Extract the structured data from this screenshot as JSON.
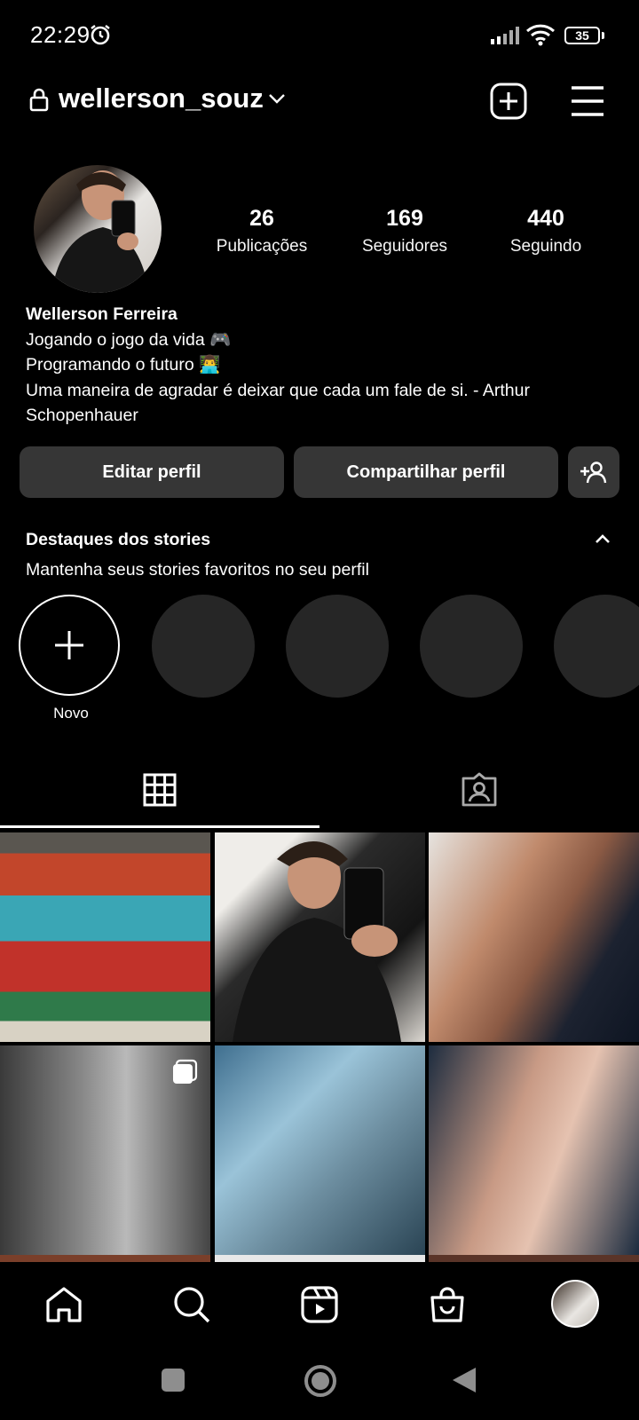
{
  "status_bar": {
    "time": "22:29",
    "battery": "35"
  },
  "header": {
    "username": "wellerson_souz"
  },
  "profile": {
    "stats": [
      {
        "count": "26",
        "label": "Publicações"
      },
      {
        "count": "169",
        "label": "Seguidores"
      },
      {
        "count": "440",
        "label": "Seguindo"
      }
    ],
    "name": "Wellerson Ferreira",
    "bio_lines": [
      "Jogando o jogo da vida 🎮",
      "Programando o futuro 👨‍💻",
      "Uma maneira de agradar é deixar que cada um fale de si. - Arthur",
      "Schopenhauer"
    ]
  },
  "actions": {
    "edit": "Editar perfil",
    "share": "Compartilhar perfil"
  },
  "highlights": {
    "title": "Destaques dos stories",
    "subtitle": "Mantenha seus stories favoritos no seu perfil",
    "new_label": "Novo"
  },
  "icons": {
    "header": [
      "lock-icon",
      "chevron-down-icon",
      "new-post-icon",
      "menu-icon"
    ],
    "tabs": [
      "grid-icon",
      "tagged-icon"
    ],
    "nav": [
      "home-icon",
      "search-icon",
      "reels-icon",
      "shop-icon",
      "profile-avatar"
    ]
  }
}
